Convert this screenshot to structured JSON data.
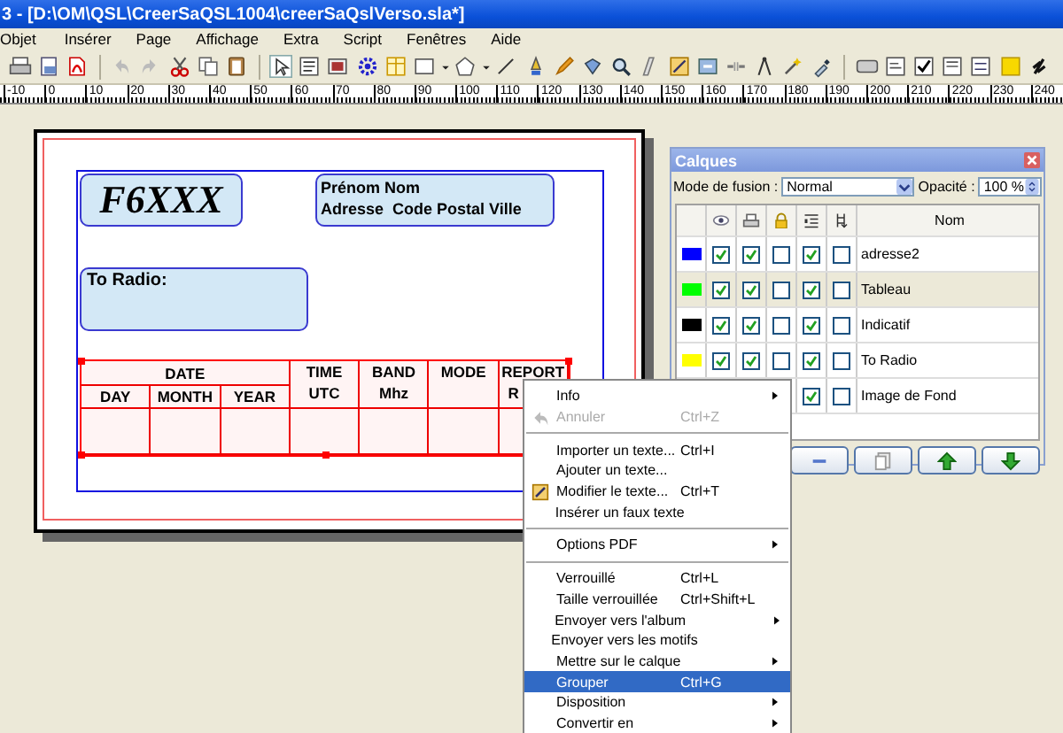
{
  "window": {
    "title": "3 - [D:\\OM\\QSL\\CreerSaQSL1004\\creerSaQslVerso.sla*]"
  },
  "menu_bar": [
    "Objet",
    "Insérer",
    "Page",
    "Affichage",
    "Extra",
    "Script",
    "Fenêtres",
    "Aide"
  ],
  "ruler": {
    "labels": [
      "-10",
      "0",
      "10",
      "20",
      "30",
      "40",
      "50",
      "60",
      "70",
      "80",
      "90",
      "100",
      "110",
      "120",
      "130",
      "140",
      "150",
      "160",
      "170",
      "180",
      "190",
      "200",
      "210",
      "220",
      "230",
      "240"
    ]
  },
  "document": {
    "callsign": "F6XXX",
    "address_lines": [
      "Prénom Nom",
      "Adresse  Code Postal Ville"
    ],
    "to_radio": "To Radio:",
    "table": {
      "date_group": {
        "label": "DATE",
        "columns": [
          "DAY",
          "MONTH",
          "YEAR"
        ]
      },
      "columns": [
        [
          "TIME",
          "UTC"
        ],
        [
          "BAND",
          "Mhz"
        ],
        [
          "MODE"
        ],
        [
          "REPORT",
          "R"
        ]
      ]
    }
  },
  "layers": {
    "title": "Calques",
    "blend_label": "Mode de fusion :",
    "blend_value": "Normal",
    "opacity_label": "Opacité :",
    "opacity_value": "100 %",
    "name_header": "Nom",
    "rows": [
      {
        "name": "adresse2",
        "color": "#0000ff",
        "selected": false,
        "visible": true,
        "printable": true,
        "locked": false,
        "text_flow": true,
        "outline": false
      },
      {
        "name": "Tableau",
        "color": "#00ff00",
        "selected": true,
        "visible": true,
        "printable": true,
        "locked": false,
        "text_flow": true,
        "outline": false
      },
      {
        "name": "Indicatif",
        "color": "#000000",
        "selected": false,
        "visible": true,
        "printable": true,
        "locked": false,
        "text_flow": true,
        "outline": false
      },
      {
        "name": "To Radio",
        "color": "#ffff00",
        "selected": false,
        "visible": true,
        "printable": true,
        "locked": false,
        "text_flow": true,
        "outline": false
      },
      {
        "name": "Image de Fond",
        "selected": false,
        "text_flow": true,
        "outline": false
      }
    ]
  },
  "context_menu": [
    {
      "kind": "item",
      "label": "Info",
      "submenu": true,
      "disabled": false,
      "selected": false
    },
    {
      "kind": "undo",
      "label": "Annuler",
      "shortcut": "Ctrl+Z",
      "submenu": false,
      "disabled": true,
      "selected": false
    },
    {
      "kind": "separator"
    },
    {
      "kind": "item",
      "label": "Importer un texte...",
      "shortcut": "Ctrl+I",
      "submenu": false,
      "disabled": false,
      "selected": false
    },
    {
      "kind": "item",
      "label": "Ajouter un texte...",
      "submenu": false,
      "disabled": false,
      "selected": false
    },
    {
      "kind": "edit",
      "label": "Modifier le texte...",
      "shortcut": "Ctrl+T",
      "submenu": false,
      "disabled": false,
      "selected": false
    },
    {
      "kind": "item",
      "label": "Insérer un faux texte",
      "submenu": false,
      "disabled": false,
      "selected": false
    },
    {
      "kind": "separator"
    },
    {
      "kind": "item",
      "label": "Options PDF",
      "submenu": true,
      "disabled": false,
      "selected": false
    },
    {
      "kind": "separator"
    },
    {
      "kind": "item",
      "label": "Verrouillé",
      "shortcut": "Ctrl+L",
      "submenu": false,
      "disabled": false,
      "selected": false
    },
    {
      "kind": "item",
      "label": "Taille verrouillée",
      "shortcut": "Ctrl+Shift+L",
      "submenu": false,
      "disabled": false,
      "selected": false
    },
    {
      "kind": "item",
      "label": "Envoyer vers l'album",
      "submenu": true,
      "disabled": false,
      "selected": false
    },
    {
      "kind": "item",
      "label": "Envoyer vers les motifs",
      "submenu": false,
      "disabled": false,
      "selected": false
    },
    {
      "kind": "item",
      "label": "Mettre sur le calque",
      "submenu": true,
      "disabled": false,
      "selected": false
    },
    {
      "kind": "item",
      "label": "Grouper",
      "shortcut": "Ctrl+G",
      "submenu": false,
      "disabled": false,
      "selected": true
    },
    {
      "kind": "item",
      "label": "Disposition",
      "submenu": true,
      "disabled": false,
      "selected": false
    },
    {
      "kind": "item",
      "label": "Convertir en",
      "submenu": true,
      "disabled": false,
      "selected": false
    }
  ]
}
